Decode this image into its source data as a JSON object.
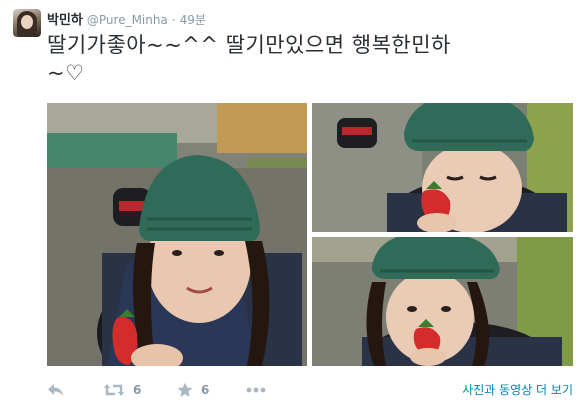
{
  "tweet": {
    "display_name": "박민하",
    "handle": "@Pure_Minha",
    "separator": "·",
    "timestamp": "49분",
    "text_line1": "딸기가좋아~~^^ 딸기만있으면 행복한민하",
    "text_line2": "~♡"
  },
  "media": {
    "photos": [
      {
        "name": "main-photo",
        "icon": "photo"
      },
      {
        "name": "top-right-photo",
        "icon": "photo"
      },
      {
        "name": "bottom-right-photo",
        "icon": "photo"
      }
    ],
    "view_more_label": "사진과 동영상 더 보기"
  },
  "actions": {
    "reply_icon": "reply-icon",
    "retweet_icon": "retweet-icon",
    "retweet_count": "6",
    "favorite_icon": "star-icon",
    "favorite_count": "6",
    "more_icon": "ellipsis-icon"
  },
  "colors": {
    "link": "#0084b4",
    "secondary_text": "#8899a6",
    "icon_gray": "#aab8c2",
    "beanie_green": "#2f6b58"
  }
}
